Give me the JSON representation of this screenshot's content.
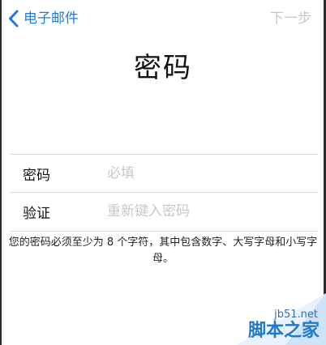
{
  "nav": {
    "back_label": "电子邮件",
    "next_label": "下一步",
    "back_icon": "chevron-left-icon"
  },
  "title": "密码",
  "form": {
    "password": {
      "label": "密码",
      "placeholder": "必填",
      "value": ""
    },
    "verify": {
      "label": "验证",
      "placeholder": "重新键入密码",
      "value": ""
    }
  },
  "hint": "您的密码必须至少为 8 个字符，其中包含数字、大写字母和小写字母。",
  "watermark": {
    "site": "jb51.net",
    "name": "脚本之家"
  },
  "colors": {
    "accent": "#1f7ae0",
    "disabled": "#c6c6c6",
    "placeholder": "#c8c8c8",
    "separator": "#dcdcdc"
  }
}
